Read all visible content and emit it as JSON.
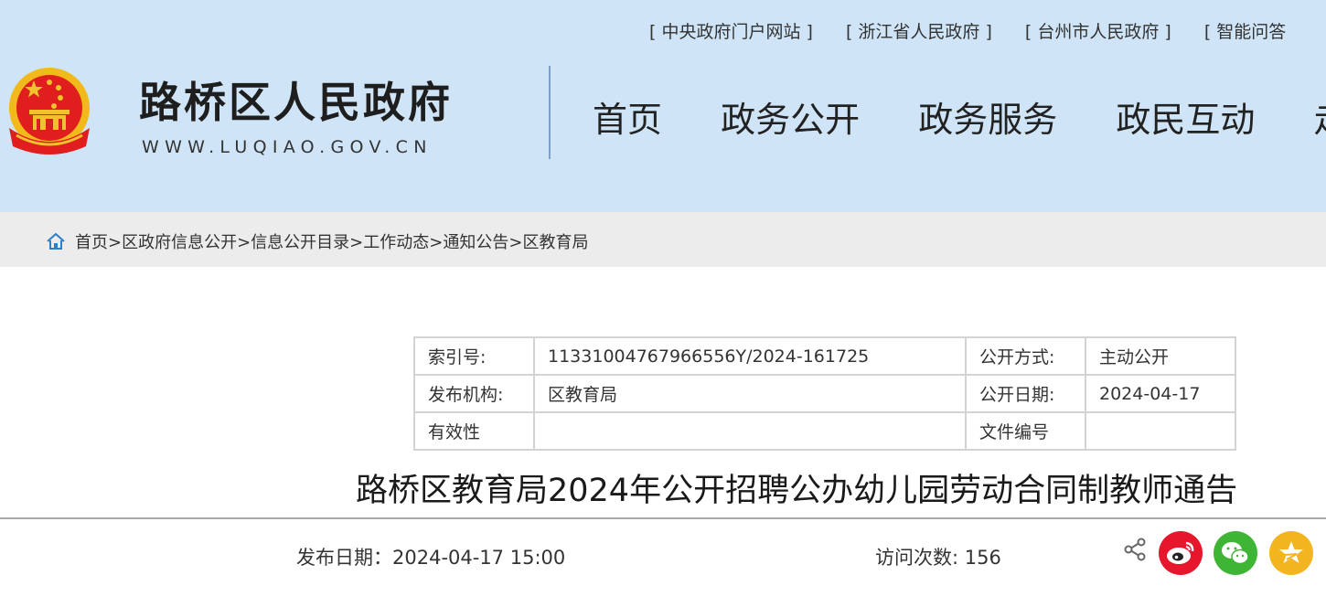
{
  "header": {
    "top_links": [
      "[ 中央政府门户网站 ]",
      "[ 浙江省人民政府 ]",
      "[ 台州市人民政府 ]",
      "[ 智能问答"
    ],
    "site_title": "路桥区人民政府",
    "site_url": "WWW.LUQIAO.GOV.CN",
    "nav": [
      "首页",
      "政务公开",
      "政务服务",
      "政民互动",
      "走进"
    ]
  },
  "breadcrumb": [
    "首页>",
    "区政府信息公开>",
    "信息公开目录>",
    "工作动态>",
    "通知公告>",
    "区教育局"
  ],
  "meta": {
    "rows": [
      {
        "k1": "索引号:",
        "v1": "11331004767966556Y/2024-161725",
        "k2": "公开方式:",
        "v2": "主动公开"
      },
      {
        "k1": "发布机构:",
        "v1": "区教育局",
        "k2": "公开日期:",
        "v2": "2024-04-17"
      },
      {
        "k1": "有效性",
        "v1": "",
        "k2": "文件编号",
        "v2": ""
      }
    ]
  },
  "article": {
    "title": "路桥区教育局2024年公开招聘公办幼儿园劳动合同制教师通告",
    "pubdate": "发布日期：2024-04-17 15:00",
    "visits": "访问次数: 156"
  },
  "icons": {
    "emblem": "national-emblem",
    "home": "home-icon",
    "share": "share-icon",
    "weibo": "weibo-icon",
    "wechat": "wechat-icon",
    "qzone": "qzone-star-icon"
  },
  "colors": {
    "header_bg": "#cfe5f7",
    "breadcrumb_bg": "#ececec",
    "weibo": "#e6162d",
    "wechat": "#3fb535",
    "qzone": "#f3b51f"
  }
}
